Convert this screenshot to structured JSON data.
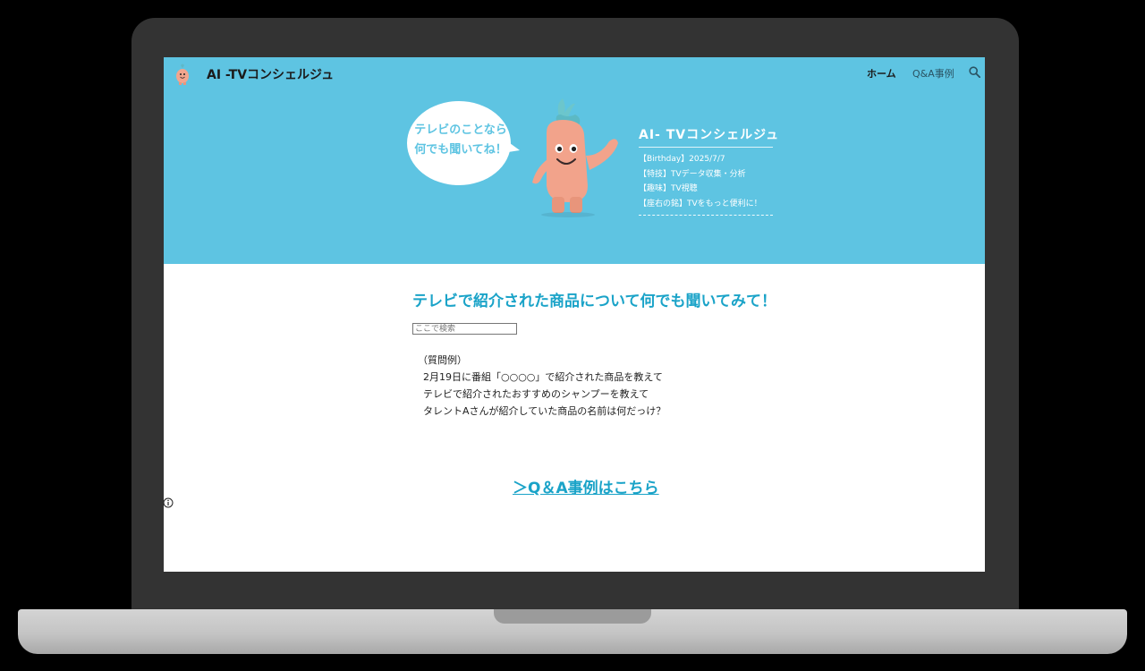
{
  "site": {
    "title": "AI -TVコンシェルジュ"
  },
  "nav": {
    "home": "ホーム",
    "qa": "Q&A事例"
  },
  "hero": {
    "bubble_line1": "テレビのことなら",
    "bubble_line2": "何でも聞いてね！",
    "profile_title": "AI- TVコンシェルジュ",
    "profile_lines": [
      "【Birthday】2025/7/7",
      "【特技】TVデータ収集・分析",
      "【趣味】TV視聴",
      "【座右の銘】TVをもっと便利に！"
    ]
  },
  "main": {
    "heading": "テレビで紹介された商品について何でも聞いてみて！",
    "search_placeholder": "ここで検索",
    "examples_label": "（質問例）",
    "examples": [
      "2月19日に番組「○○○○」で紹介された商品を教えて",
      "テレビで紹介されたおすすめのシャンプーを教えて",
      "タレントAさんが紹介していた商品の名前は何だっけ？"
    ],
    "qa_link": "＞Q＆A事例はこちら"
  },
  "colors": {
    "hero_bg": "#5ec4e2",
    "accent": "#1aa3c8",
    "frame": "#333333"
  }
}
